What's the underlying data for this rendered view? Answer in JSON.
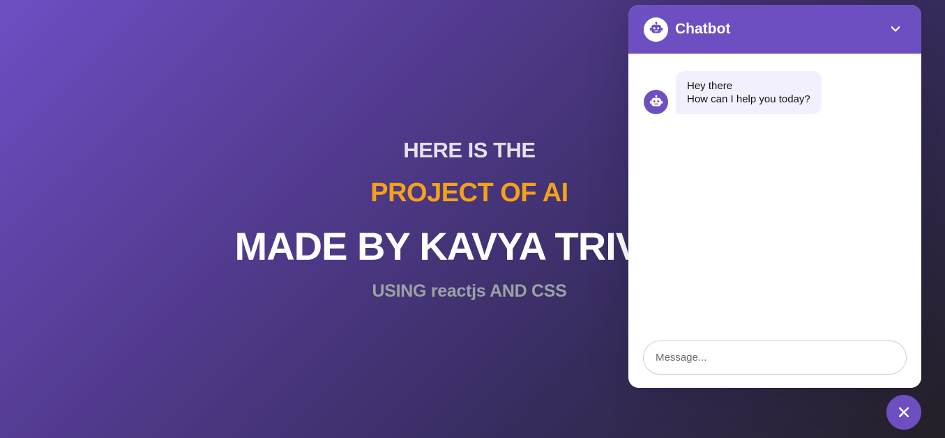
{
  "hero": {
    "line1": "HERE IS THE",
    "line2": "PROJECT OF AI",
    "line3": "MADE BY KAVYA TRIVEDI",
    "line4": "USING reactjs AND CSS"
  },
  "chatbot": {
    "title": "Chatbot",
    "header_icon": "robot-icon",
    "collapse_icon": "chevron-down-icon",
    "messages": [
      {
        "sender": "bot",
        "line1": "Hey there",
        "line2": "How can I help you today?"
      }
    ],
    "input": {
      "placeholder": "Message...",
      "value": ""
    },
    "toggle_icon": "close-icon"
  },
  "colors": {
    "accent": "#6d4fc2",
    "highlight": "#f4a21a",
    "bubble": "#f3f0fd"
  }
}
